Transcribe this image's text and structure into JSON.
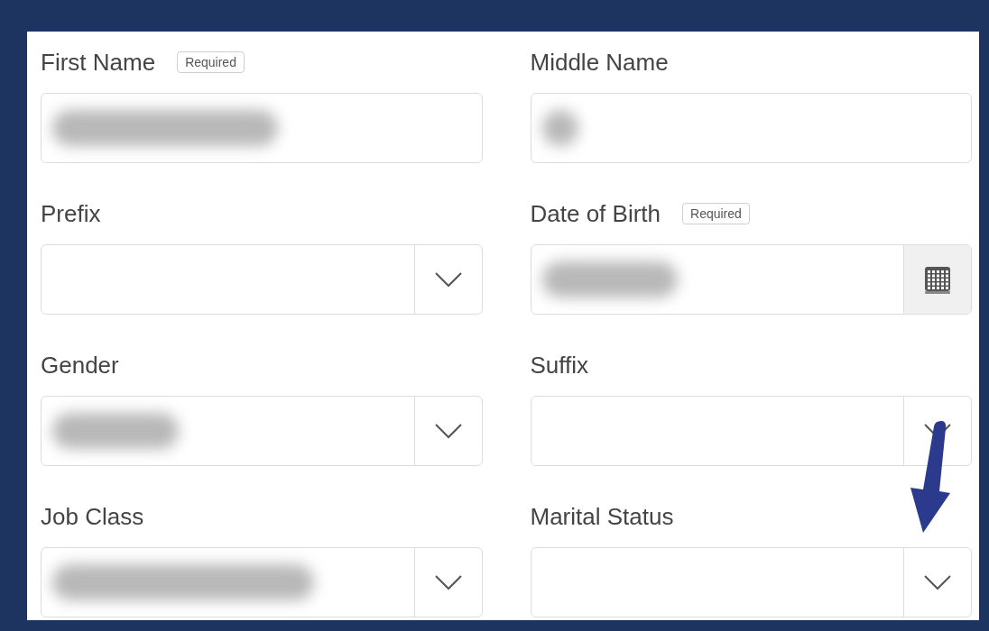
{
  "fields": [
    {
      "label": "First Name",
      "required_badge": "Required",
      "kind": "text",
      "blurred": true
    },
    {
      "label": "Middle Name",
      "kind": "text",
      "blurred": true
    },
    {
      "label": "Prefix",
      "kind": "select",
      "blurred": false
    },
    {
      "label": "Date of Birth",
      "required_badge": "Required",
      "kind": "date",
      "blurred": true
    },
    {
      "label": "Gender",
      "kind": "select",
      "blurred": true
    },
    {
      "label": "Suffix",
      "kind": "select",
      "blurred": false
    },
    {
      "label": "Job Class",
      "kind": "select",
      "blurred": true
    },
    {
      "label": "Marital Status",
      "kind": "select",
      "blurred": false,
      "annotated": true
    }
  ]
}
